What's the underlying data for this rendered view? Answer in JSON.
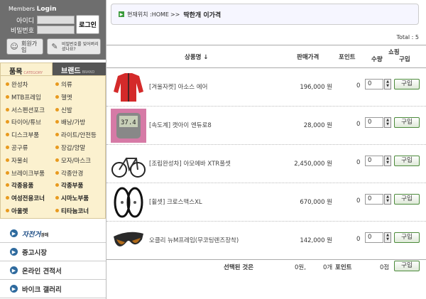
{
  "login": {
    "title_prefix": "Members ",
    "title": "Login",
    "id_label": "아이디",
    "pw_label": "비밀번호",
    "login_button": "로그인",
    "join_label": "회원가입",
    "find_pw_label": "비밀번호를 잊어버리셨나요?"
  },
  "tabs": {
    "category": "품목",
    "category_sub": "CATEGORY",
    "brand": "브랜드",
    "brand_sub": "BRAND"
  },
  "categories": [
    "완성차",
    "의류",
    "MTB프레임",
    "헬멧",
    "서스펜션포크",
    "신발",
    "타이어/튜브",
    "배낭/가방",
    "디스크부품",
    "라이트/안전등",
    "공구류",
    "장갑/양말",
    "자물쇠",
    "모자/마스크",
    "브레이크부품",
    "각종안경",
    "각종용품",
    "각종부품",
    "여성전용코너",
    "시마노부품",
    "아울렛",
    "티타늄코너"
  ],
  "menu": {
    "brand_title": "자전거",
    "brand_sub": "경매",
    "items": [
      "중고시장",
      "온라인 견적서",
      "바이크 갤러리"
    ]
  },
  "breadcrumb": {
    "prefix": "현재위치 : ",
    "home": "HOME",
    "sep": ">>",
    "current": "딱한개 이가격"
  },
  "total_label": "Total : 5",
  "table": {
    "col_name": "상품명 ↓",
    "col_price": "판매가격",
    "col_point": "포인트",
    "col_shop": "쇼핑",
    "col_qty": "수량",
    "col_buy": "구입",
    "rows": [
      {
        "name": "[겨울자켓] 아소스 에어",
        "price": "196,000 원",
        "point": "0",
        "qty": "0",
        "buy": "구입"
      },
      {
        "name": "[속도계] 캣아이 엔듀로8",
        "price": "28,000 원",
        "point": "0",
        "qty": "0",
        "buy": "구입"
      },
      {
        "name": "[조립완성차] 아모에바 XTR풀셋",
        "price": "2,450,000 원",
        "point": "0",
        "qty": "0",
        "buy": "구입"
      },
      {
        "name": "[휠셋] 크로스맥스XL",
        "price": "670,000 원",
        "point": "0",
        "qty": "0",
        "buy": "구입"
      },
      {
        "name": "오클리 뉴M프레임(무코팅렌즈장착)",
        "price": "142,000 원",
        "point": "0",
        "qty": "0",
        "buy": "구입"
      }
    ]
  },
  "footer": {
    "selected_label": "선택된 것은",
    "amount": "0원,",
    "count": "0개",
    "point_label": "포인트",
    "points": "0점",
    "buy": "구입"
  }
}
